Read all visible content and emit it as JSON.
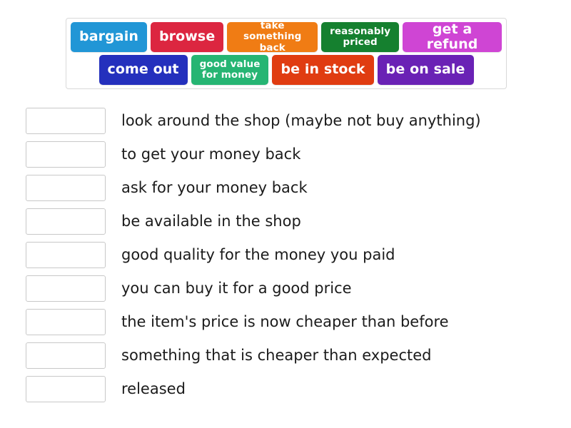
{
  "tile_bank": {
    "name": "word-tile-bank",
    "rows": [
      {
        "tiles": [
          {
            "label": "bargain",
            "color": "#2196d6",
            "lines": 1
          },
          {
            "label": "browse",
            "color": "#dc2640",
            "lines": 1
          },
          {
            "label": "take something\nback",
            "color": "#f07c14",
            "lines": 2
          },
          {
            "label": "reasonably\npriced",
            "color": "#15802f",
            "lines": 2
          },
          {
            "label": "get a refund",
            "color": "#cf45d4",
            "lines": 1
          }
        ]
      },
      {
        "tiles": [
          {
            "label": "come out",
            "color": "#2430bd",
            "lines": 1
          },
          {
            "label": "good value\nfor money",
            "color": "#26b573",
            "lines": 2
          },
          {
            "label": "be in stock",
            "color": "#e03c11",
            "lines": 1
          },
          {
            "label": "be on sale",
            "color": "#6a22b5",
            "lines": 1
          }
        ]
      }
    ]
  },
  "answers": [
    {
      "box_value": "",
      "definition": "look around the shop (maybe not buy anything)"
    },
    {
      "box_value": "",
      "definition": "to get your money back"
    },
    {
      "box_value": "",
      "definition": "ask for your money back"
    },
    {
      "box_value": "",
      "definition": "be available in the shop"
    },
    {
      "box_value": "",
      "definition": "good quality for the money you paid"
    },
    {
      "box_value": "",
      "definition": "you can buy it for a good price"
    },
    {
      "box_value": "",
      "definition": "the item's price is now cheaper than before"
    },
    {
      "box_value": "",
      "definition": "something that is cheaper than expected"
    },
    {
      "box_value": "",
      "definition": "released"
    }
  ]
}
